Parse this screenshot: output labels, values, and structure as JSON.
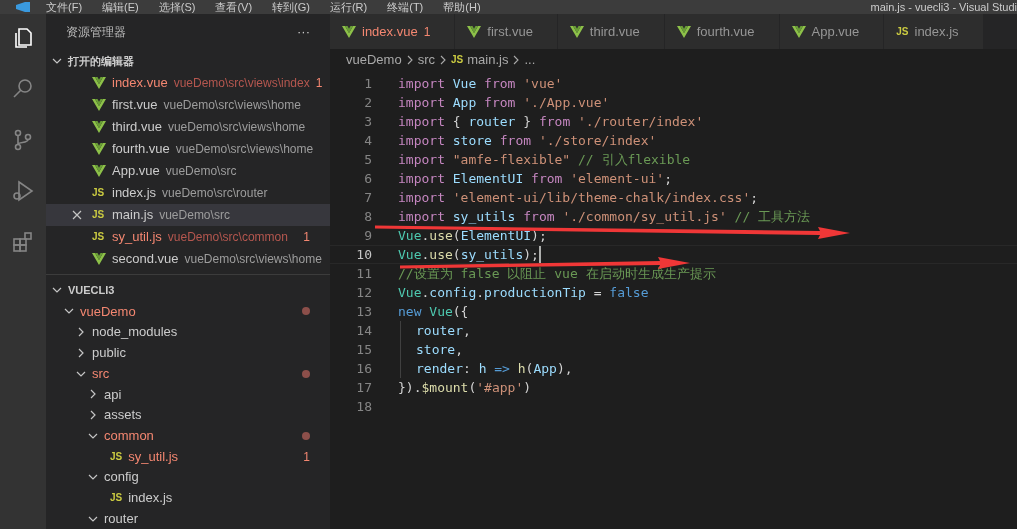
{
  "menu_bar": {
    "items": [
      "文件(F)",
      "编辑(E)",
      "选择(S)",
      "查看(V)",
      "转到(G)",
      "运行(R)",
      "终端(T)",
      "帮助(H)"
    ],
    "title": "main.js - vuecli3 - Visual Studi"
  },
  "activity_bar": [
    {
      "kind": "files",
      "selected": true
    },
    {
      "kind": "search",
      "selected": false
    },
    {
      "kind": "git",
      "selected": false
    },
    {
      "kind": "debug",
      "selected": false
    },
    {
      "kind": "extensions",
      "selected": false
    }
  ],
  "sidebar": {
    "title": "资源管理器",
    "more": "···",
    "open_editors": {
      "title": "打开的编辑器",
      "expanded": true,
      "items": [
        {
          "name": "index.vue",
          "path": "vueDemo\\src\\views\\index",
          "kind": "vue",
          "error": true,
          "badge": "1",
          "selected": false
        },
        {
          "name": "first.vue",
          "path": "vueDemo\\src\\views\\home",
          "kind": "vue",
          "error": false,
          "selected": false
        },
        {
          "name": "third.vue",
          "path": "vueDemo\\src\\views\\home",
          "kind": "vue",
          "error": false,
          "selected": false
        },
        {
          "name": "fourth.vue",
          "path": "vueDemo\\src\\views\\home",
          "kind": "vue",
          "error": false,
          "selected": false
        },
        {
          "name": "App.vue",
          "path": "vueDemo\\src",
          "kind": "vue",
          "error": false,
          "selected": false
        },
        {
          "name": "index.js",
          "path": "vueDemo\\src\\router",
          "kind": "js",
          "icon": "JS",
          "error": false,
          "selected": false
        },
        {
          "name": "main.js",
          "path": "vueDemo\\src",
          "kind": "js",
          "icon": "JS",
          "error": false,
          "selected": true
        },
        {
          "name": "sy_util.js",
          "path": "vueDemo\\src\\common",
          "kind": "js",
          "icon": "JS",
          "error": true,
          "badge": "1",
          "selected": false
        },
        {
          "name": "second.vue",
          "path": "vueDemo\\src\\views\\home",
          "kind": "vue",
          "error": false,
          "selected": false
        }
      ]
    },
    "project": {
      "title": "VUECLI3",
      "expanded": true,
      "tree": [
        {
          "name": "vueDemo",
          "kind": "folder",
          "expanded": true,
          "modified": true,
          "children": [
            {
              "name": "node_modules",
              "kind": "folder",
              "expanded": false,
              "modified": false
            },
            {
              "name": "public",
              "kind": "folder",
              "expanded": false,
              "modified": false
            },
            {
              "name": "src",
              "kind": "folder",
              "expanded": true,
              "modified": true,
              "children": [
                {
                  "name": "api",
                  "kind": "folder",
                  "expanded": false,
                  "modified": false
                },
                {
                  "name": "assets",
                  "kind": "folder",
                  "expanded": false,
                  "modified": false
                },
                {
                  "name": "common",
                  "kind": "folder",
                  "expanded": true,
                  "modified": true,
                  "children": [
                    {
                      "name": "sy_util.js",
                      "kind": "js",
                      "icon": "JS",
                      "modified": true,
                      "badge": "1"
                    }
                  ]
                },
                {
                  "name": "config",
                  "kind": "folder",
                  "expanded": true,
                  "modified": false,
                  "children": [
                    {
                      "name": "index.js",
                      "kind": "js",
                      "icon": "JS",
                      "modified": false
                    }
                  ]
                },
                {
                  "name": "router",
                  "kind": "folder",
                  "expanded": true,
                  "modified": false
                }
              ]
            }
          ]
        }
      ]
    }
  },
  "tabs": [
    {
      "label": "index.vue",
      "kind": "vue",
      "error": true,
      "badge": "1",
      "selected": false
    },
    {
      "label": "first.vue",
      "kind": "vue",
      "error": false,
      "selected": false
    },
    {
      "label": "third.vue",
      "kind": "vue",
      "error": false,
      "selected": false
    },
    {
      "label": "fourth.vue",
      "kind": "vue",
      "error": false,
      "selected": false
    },
    {
      "label": "App.vue",
      "kind": "vue",
      "error": false,
      "selected": false
    },
    {
      "label": "index.js",
      "kind": "js",
      "icon": "JS",
      "error": false,
      "selected": false
    }
  ],
  "breadcrumb": [
    {
      "label": "vueDemo",
      "kind": "text"
    },
    {
      "label": "src",
      "kind": "text"
    },
    {
      "label": "main.js",
      "kind": "js",
      "icon": "JS"
    },
    {
      "label": "...",
      "kind": "text"
    }
  ],
  "code": {
    "lines": [
      {
        "number": "1",
        "selected": false,
        "tokens": [
          {
            "kind": "keyword",
            "text": "import "
          },
          {
            "kind": "var",
            "text": "Vue "
          },
          {
            "kind": "keyword",
            "text": "from "
          },
          {
            "kind": "string",
            "text": "'vue'"
          }
        ]
      },
      {
        "number": "2",
        "selected": false,
        "tokens": [
          {
            "kind": "keyword",
            "text": "import "
          },
          {
            "kind": "var",
            "text": "App "
          },
          {
            "kind": "keyword",
            "text": "from "
          },
          {
            "kind": "string",
            "text": "'./App.vue'"
          }
        ]
      },
      {
        "number": "3",
        "selected": false,
        "tokens": [
          {
            "kind": "keyword",
            "text": "import "
          },
          {
            "kind": "plain",
            "text": "{ "
          },
          {
            "kind": "var",
            "text": "router "
          },
          {
            "kind": "plain",
            "text": "} "
          },
          {
            "kind": "keyword",
            "text": "from "
          },
          {
            "kind": "string",
            "text": "'./router/index'"
          }
        ]
      },
      {
        "number": "4",
        "selected": false,
        "tokens": [
          {
            "kind": "keyword",
            "text": "import "
          },
          {
            "kind": "var",
            "text": "store "
          },
          {
            "kind": "keyword",
            "text": "from "
          },
          {
            "kind": "string",
            "text": "'./store/index'"
          }
        ]
      },
      {
        "number": "5",
        "selected": false,
        "tokens": [
          {
            "kind": "keyword",
            "text": "import "
          },
          {
            "kind": "string",
            "text": "\"amfe-flexible\" "
          },
          {
            "kind": "comment",
            "text": "// 引入flexible"
          }
        ]
      },
      {
        "number": "6",
        "selected": false,
        "tokens": [
          {
            "kind": "keyword",
            "text": "import "
          },
          {
            "kind": "var",
            "text": "ElementUI "
          },
          {
            "kind": "keyword",
            "text": "from "
          },
          {
            "kind": "string",
            "text": "'element-ui'"
          },
          {
            "kind": "plain",
            "text": ";"
          }
        ]
      },
      {
        "number": "7",
        "selected": false,
        "tokens": [
          {
            "kind": "keyword",
            "text": "import "
          },
          {
            "kind": "string",
            "text": "'element-ui/lib/theme-chalk/index.css'"
          },
          {
            "kind": "plain",
            "text": ";"
          }
        ]
      },
      {
        "number": "8",
        "selected": false,
        "tokens": [
          {
            "kind": "keyword",
            "text": "import "
          },
          {
            "kind": "var",
            "text": "sy_utils "
          },
          {
            "kind": "keyword",
            "text": "from "
          },
          {
            "kind": "string",
            "text": "'./common/sy_util.js' "
          },
          {
            "kind": "comment",
            "text": "// 工具方法"
          }
        ]
      },
      {
        "number": "9",
        "selected": false,
        "tokens": [
          {
            "kind": "class",
            "text": "Vue"
          },
          {
            "kind": "plain",
            "text": "."
          },
          {
            "kind": "function",
            "text": "use"
          },
          {
            "kind": "plain",
            "text": "("
          },
          {
            "kind": "var",
            "text": "ElementUI"
          },
          {
            "kind": "plain",
            "text": ");"
          }
        ]
      },
      {
        "number": "10",
        "selected": true,
        "tokens": [
          {
            "kind": "class",
            "text": "Vue"
          },
          {
            "kind": "plain",
            "text": "."
          },
          {
            "kind": "function",
            "text": "use"
          },
          {
            "kind": "plain",
            "text": "("
          },
          {
            "kind": "var",
            "text": "sy_utils"
          },
          {
            "kind": "plain",
            "text": ");"
          }
        ]
      },
      {
        "number": "11",
        "selected": false,
        "tokens": [
          {
            "kind": "comment",
            "text": "//设置为 false 以阻止 vue 在启动时生成生产提示"
          }
        ]
      },
      {
        "number": "12",
        "selected": false,
        "tokens": [
          {
            "kind": "class",
            "text": "Vue"
          },
          {
            "kind": "plain",
            "text": "."
          },
          {
            "kind": "var",
            "text": "config"
          },
          {
            "kind": "plain",
            "text": "."
          },
          {
            "kind": "var",
            "text": "productionTip "
          },
          {
            "kind": "plain",
            "text": "= "
          },
          {
            "kind": "bool",
            "text": "false"
          }
        ]
      },
      {
        "number": "13",
        "selected": false,
        "tokens": [
          {
            "kind": "bool",
            "text": "new "
          },
          {
            "kind": "class",
            "text": "Vue"
          },
          {
            "kind": "plain",
            "text": "({"
          }
        ]
      },
      {
        "number": "14",
        "selected": false,
        "indented": true,
        "tokens": [
          {
            "kind": "var",
            "text": "router"
          },
          {
            "kind": "plain",
            "text": ","
          }
        ]
      },
      {
        "number": "15",
        "selected": false,
        "indented": true,
        "tokens": [
          {
            "kind": "var",
            "text": "store"
          },
          {
            "kind": "plain",
            "text": ","
          }
        ]
      },
      {
        "number": "16",
        "selected": false,
        "indented": true,
        "tokens": [
          {
            "kind": "var",
            "text": "render"
          },
          {
            "kind": "plain",
            "text": ": "
          },
          {
            "kind": "var",
            "text": "h "
          },
          {
            "kind": "bool",
            "text": "=> "
          },
          {
            "kind": "function",
            "text": "h"
          },
          {
            "kind": "plain",
            "text": "("
          },
          {
            "kind": "var",
            "text": "App"
          },
          {
            "kind": "plain",
            "text": "),"
          }
        ]
      },
      {
        "number": "17",
        "selected": false,
        "tokens": [
          {
            "kind": "plain",
            "text": "})."
          },
          {
            "kind": "function",
            "text": "$mount"
          },
          {
            "kind": "plain",
            "text": "("
          },
          {
            "kind": "string",
            "text": "'#app'"
          },
          {
            "kind": "plain",
            "text": ")"
          }
        ]
      },
      {
        "number": "18",
        "selected": false
      }
    ]
  },
  "annotations": [
    {
      "kind": "arrow"
    },
    {
      "kind": "arrow"
    }
  ]
}
